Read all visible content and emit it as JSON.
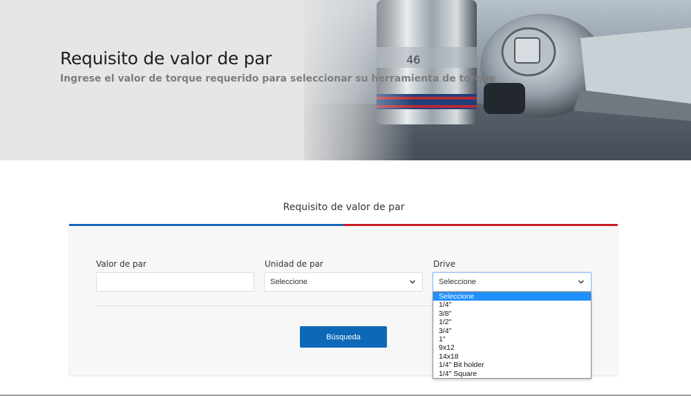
{
  "hero": {
    "title": "Requisito de valor de par",
    "subtitle": "Ingrese el valor de torque requerido para seleccionar su herramienta de torque"
  },
  "section": {
    "title": "Requisito de valor de par"
  },
  "form": {
    "torque_value_label": "Valor de par",
    "torque_value": "",
    "torque_unit_label": "Unidad de par",
    "torque_unit_selected": "Seleccione",
    "drive_label": "Drive",
    "drive_selected": "Seleccione",
    "drive_options": [
      "Seleccione",
      "1/4\"",
      "3/8\"",
      "1/2\"",
      "3/4\"",
      "1\"",
      "9x12",
      "14x18",
      "1/4\" Bit holder",
      "1/4\" Square"
    ],
    "search_label": "Búsqueda"
  },
  "colors": {
    "accent_blue": "#0d69b8",
    "accent_red": "#cc1b22",
    "highlight": "#1e90ff"
  },
  "icons": {
    "dropdown": "chevron-down-icon",
    "hero_image": "socket-wrench-photo"
  }
}
